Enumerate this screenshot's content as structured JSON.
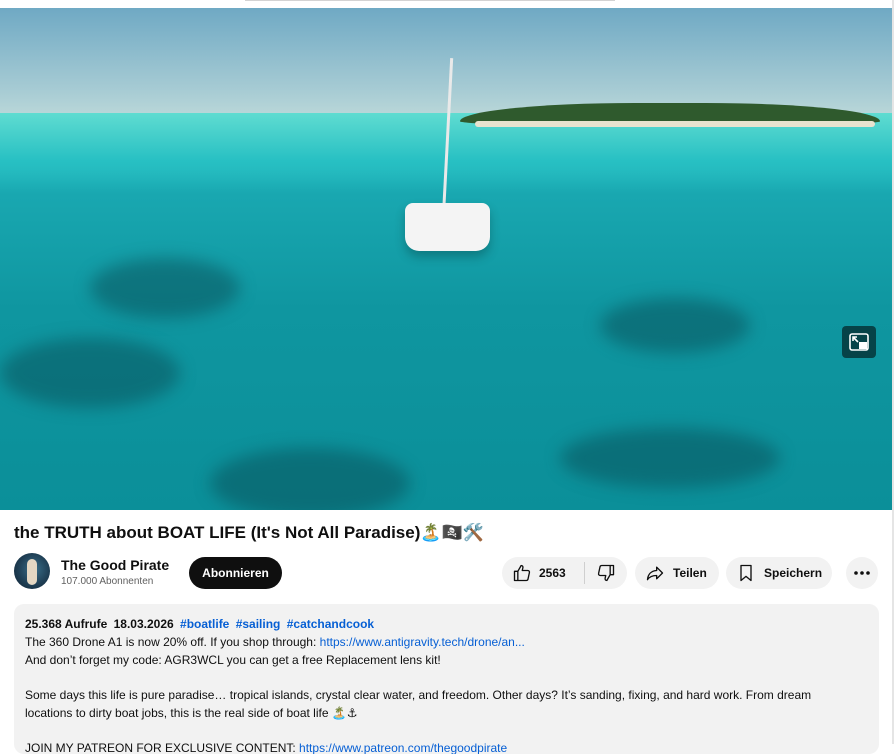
{
  "video": {
    "title": "the TRUTH about BOAT LIFE (It's Not All Paradise)",
    "title_emoji": "🏝️🏴‍☠️🛠️"
  },
  "channel": {
    "name": "The Good Pirate",
    "subscribers": "107.000 Abonnenten",
    "subscribe_label": "Abonnieren"
  },
  "actions": {
    "like_count": "2563",
    "share_label": "Teilen",
    "save_label": "Speichern"
  },
  "description": {
    "views": "25.368 Aufrufe",
    "date": "18.03.2026",
    "hashtags": [
      "#boatlife",
      "#sailing",
      "#catchandcook"
    ],
    "line1_text": "The 360 Drone A1 is now 20% off. If you shop through: ",
    "line1_link": "https://www.antigravity.tech/drone/an...",
    "line2": " And don’t forget my code: AGR3WCL you can get a free Replacement lens kit!",
    "para2_line1": "Some days this life is pure paradise… tropical islands, crystal clear water, and freedom. Other days? It’s sanding, fixing, and hard work. From dream",
    "para2_line2": "locations to dirty boat jobs, this is the real side of boat life ",
    "para2_emoji": "🏝️⚓",
    "partial_line": "JOIN MY PATREON FOR EXCLUSIVE CONTENT: ",
    "partial_link": "https://www.patreon.com/thegoodpirate"
  },
  "icons": {
    "pip": "miniplayer-icon",
    "like": "thumbs-up-icon",
    "dislike": "thumbs-down-icon",
    "share": "share-arrow-icon",
    "save": "bookmark-icon",
    "more": "more-horizontal-icon"
  }
}
